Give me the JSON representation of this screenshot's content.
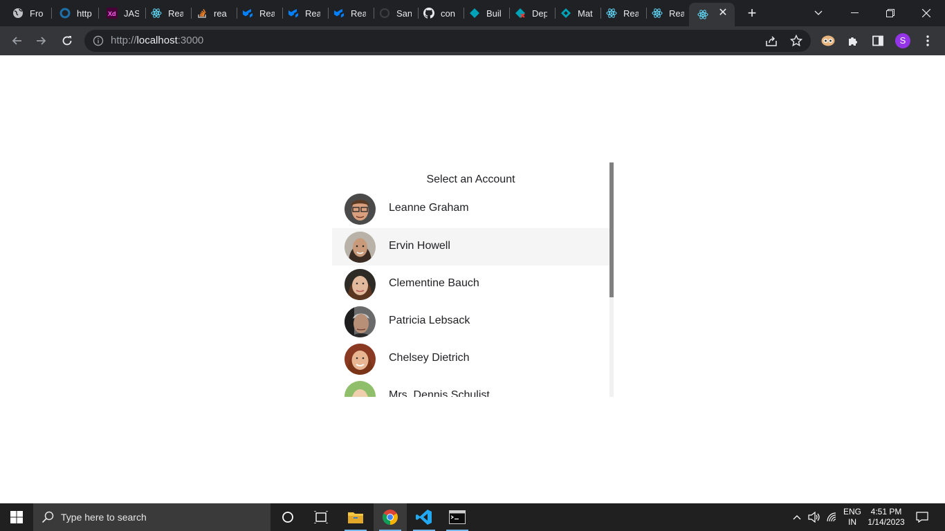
{
  "browser": {
    "tabs": [
      {
        "title": "Fro",
        "icon": "globe-icon"
      },
      {
        "title": "http",
        "icon": "ring-icon"
      },
      {
        "title": "JAS",
        "icon": "adobe-xd-icon"
      },
      {
        "title": "Rea",
        "icon": "react-icon"
      },
      {
        "title": "rea",
        "icon": "stackoverflow-icon"
      },
      {
        "title": "Rea",
        "icon": "mui-icon"
      },
      {
        "title": "Rea",
        "icon": "mui-icon"
      },
      {
        "title": "Rea",
        "icon": "mui-icon"
      },
      {
        "title": "San",
        "icon": "codesandbox-icon"
      },
      {
        "title": "con",
        "icon": "github-icon"
      },
      {
        "title": "Buil",
        "icon": "diamond-icon"
      },
      {
        "title": "Dep",
        "icon": "diamond-error-icon"
      },
      {
        "title": "Mat",
        "icon": "material-icon"
      },
      {
        "title": "Rea",
        "icon": "react-icon"
      },
      {
        "title": "Rea",
        "icon": "react-icon"
      }
    ],
    "url_scheme": "http://",
    "url_host": "localhost",
    "url_port": ":3000",
    "profile_initial": "S"
  },
  "page": {
    "title": "Select an Account",
    "accounts": [
      {
        "name": "Leanne Graham"
      },
      {
        "name": "Ervin Howell"
      },
      {
        "name": "Clementine Bauch"
      },
      {
        "name": "Patricia Lebsack"
      },
      {
        "name": "Chelsey Dietrich"
      },
      {
        "name": "Mrs. Dennis Schulist"
      }
    ],
    "highlighted_index": 1
  },
  "taskbar": {
    "search_placeholder": "Type here to search",
    "lang_line1": "ENG",
    "lang_line2": "IN",
    "time": "4:51 PM",
    "date": "1/14/2023"
  },
  "colors": {
    "accent_profile": "#9334e6",
    "react_blue": "#61dafb",
    "mui_blue": "#007fff"
  }
}
